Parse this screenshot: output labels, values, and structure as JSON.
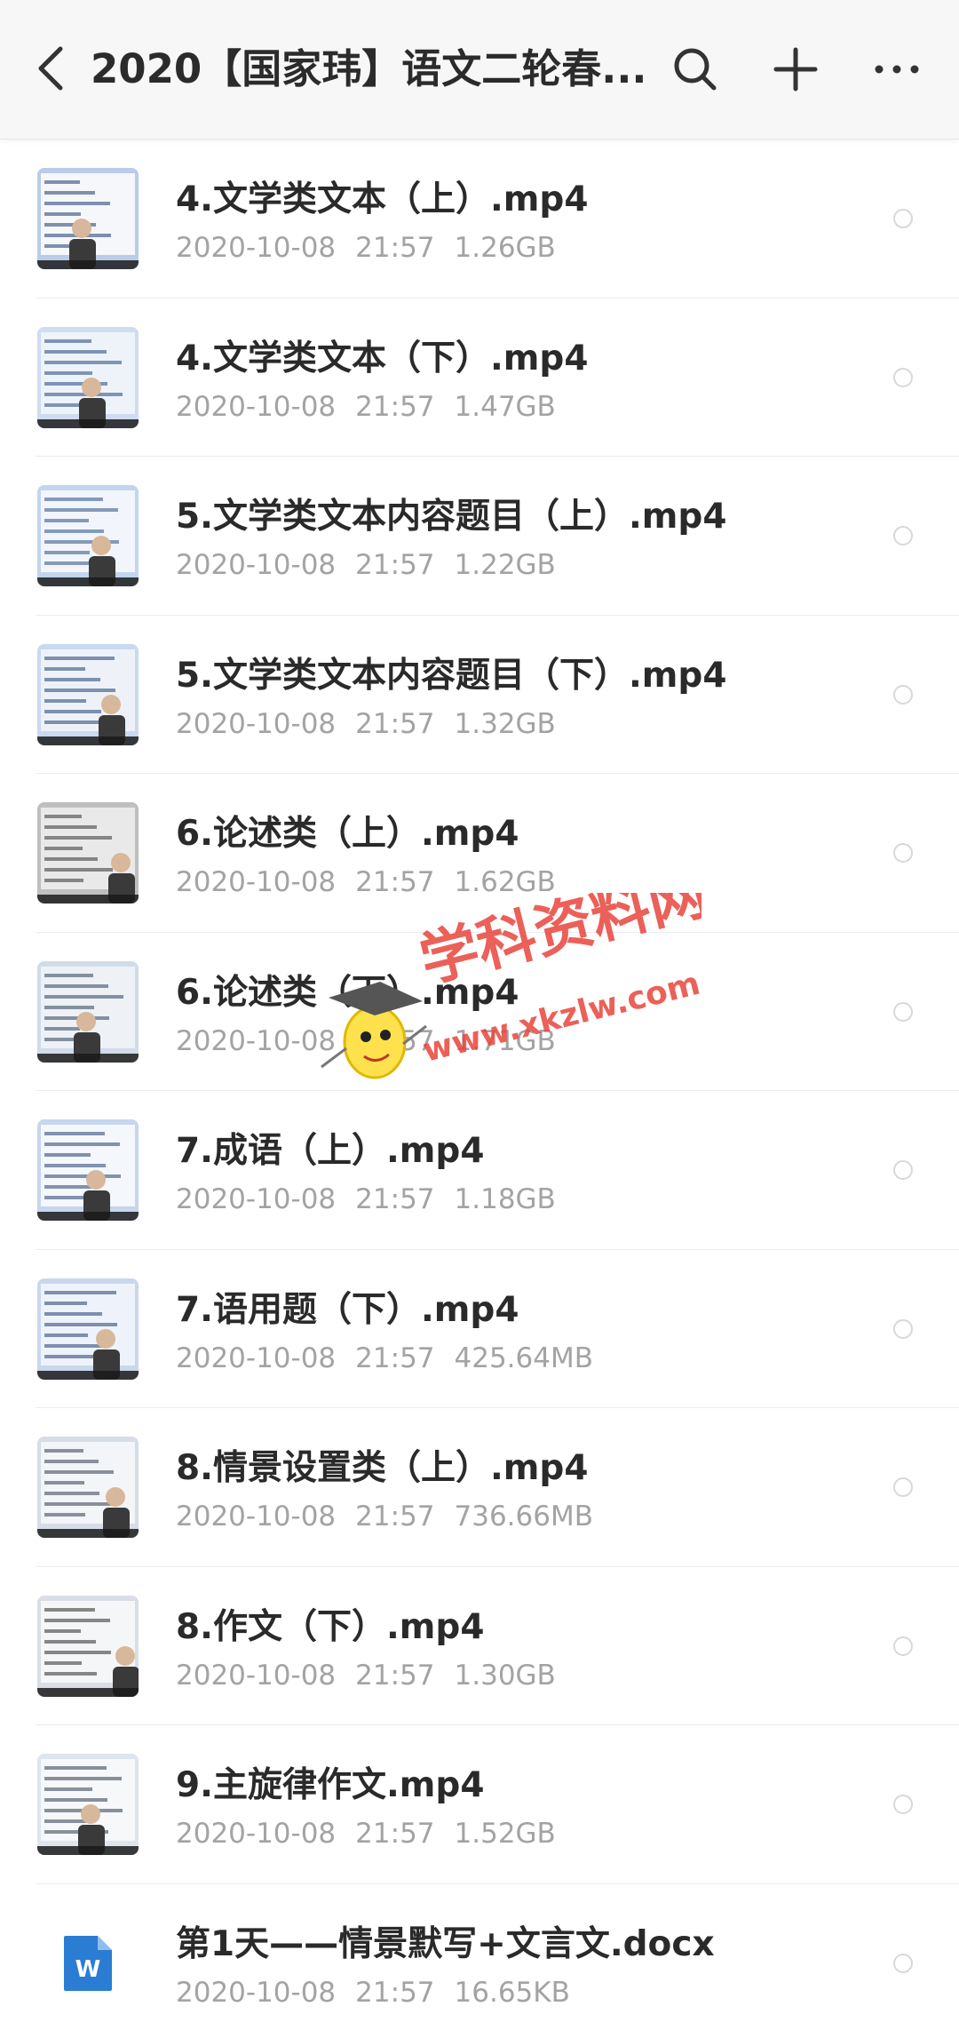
{
  "header": {
    "title": "2020【国家玮】语文二轮春...",
    "back_icon": "chevron-left-icon",
    "search_icon": "search-icon",
    "add_icon": "plus-icon",
    "more_icon": "more-horizontal-icon"
  },
  "files": [
    {
      "name": "4.文学类文本（上）.mp4",
      "date": "2020-10-08",
      "time": "21:57",
      "size": "1.26GB",
      "type": "video"
    },
    {
      "name": "4.文学类文本（下）.mp4",
      "date": "2020-10-08",
      "time": "21:57",
      "size": "1.47GB",
      "type": "video"
    },
    {
      "name": "5.文学类文本内容题目（上）.mp4",
      "date": "2020-10-08",
      "time": "21:57",
      "size": "1.22GB",
      "type": "video"
    },
    {
      "name": "5.文学类文本内容题目（下）.mp4",
      "date": "2020-10-08",
      "time": "21:57",
      "size": "1.32GB",
      "type": "video"
    },
    {
      "name": "6.论述类（上）.mp4",
      "date": "2020-10-08",
      "time": "21:57",
      "size": "1.62GB",
      "type": "video"
    },
    {
      "name": "6.论述类（下）.mp4",
      "date": "2020-10-08",
      "time": "21:57",
      "size": "1.71GB",
      "type": "video"
    },
    {
      "name": "7.成语（上）.mp4",
      "date": "2020-10-08",
      "time": "21:57",
      "size": "1.18GB",
      "type": "video"
    },
    {
      "name": "7.语用题（下）.mp4",
      "date": "2020-10-08",
      "time": "21:57",
      "size": "425.64MB",
      "type": "video"
    },
    {
      "name": "8.情景设置类（上）.mp4",
      "date": "2020-10-08",
      "time": "21:57",
      "size": "736.66MB",
      "type": "video"
    },
    {
      "name": "8.作文（下）.mp4",
      "date": "2020-10-08",
      "time": "21:57",
      "size": "1.30GB",
      "type": "video"
    },
    {
      "name": "9.主旋律作文.mp4",
      "date": "2020-10-08",
      "time": "21:57",
      "size": "1.52GB",
      "type": "video"
    },
    {
      "name": "第1天——情景默写+文言文.docx",
      "date": "2020-10-08",
      "time": "21:57",
      "size": "16.65KB",
      "type": "docx",
      "doc_badge": "W"
    }
  ],
  "watermark": {
    "text_cn": "学科资料网",
    "text_url": "www.xkzlw.com"
  },
  "colors": {
    "title": "#2b2b2b",
    "meta": "#a3a3a3",
    "docx_blue": "#2b7cd3",
    "watermark_red": "#e8453c",
    "watermark_blue": "#2c7fd9",
    "watermark_green": "#5cc450"
  }
}
